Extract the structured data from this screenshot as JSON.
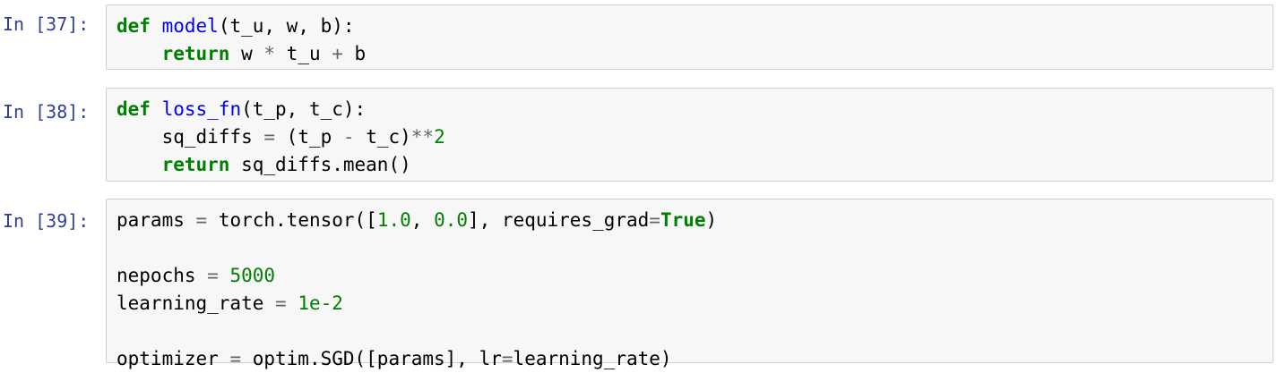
{
  "cells": [
    {
      "prompt": "In [37]:",
      "tokens": {
        "l1_kw": "def",
        "l1_fn": "model",
        "l1_rest": "(t_u, w, b):",
        "l2_indent": "    ",
        "l2_kw": "return",
        "l2_a": " w ",
        "l2_op1": "*",
        "l2_b": " t_u ",
        "l2_op2": "+",
        "l2_c": " b"
      }
    },
    {
      "prompt": "In [38]:",
      "tokens": {
        "l1_kw": "def",
        "l1_fn": "loss_fn",
        "l1_rest": "(t_p, t_c):",
        "l2_a": "    sq_diffs ",
        "l2_op1": "=",
        "l2_b": " (t_p ",
        "l2_op2": "-",
        "l2_c": " t_c)",
        "l2_op3": "**",
        "l2_num": "2",
        "l3_indent": "    ",
        "l3_kw": "return",
        "l3_rest": " sq_diffs.mean()"
      }
    },
    {
      "prompt": "In [39]:",
      "tokens": {
        "l1_a": "params ",
        "l1_op": "=",
        "l1_b": " torch.tensor([",
        "l1_n1": "1.0",
        "l1_c": ", ",
        "l1_n2": "0.0",
        "l1_d": "], requires_grad",
        "l1_op2": "=",
        "l1_kc": "True",
        "l1_e": ")",
        "l3_a": "nepochs ",
        "l3_op": "=",
        "l3_sp": " ",
        "l3_num": "5000",
        "l4_a": "learning_rate ",
        "l4_op": "=",
        "l4_sp": " ",
        "l4_num": "1e-2",
        "l6_a": "optimizer ",
        "l6_op": "=",
        "l6_b": " optim.SGD([params], lr",
        "l6_op2": "=",
        "l6_c": "learning_rate)"
      }
    }
  ],
  "colors": {
    "prompt": "#303f9f",
    "keyword": "#008000",
    "function_name": "#0000ff",
    "operator": "#666666",
    "number": "#008000",
    "cell_background": "#f7f7f7",
    "cell_border": "#cfcfcf"
  }
}
